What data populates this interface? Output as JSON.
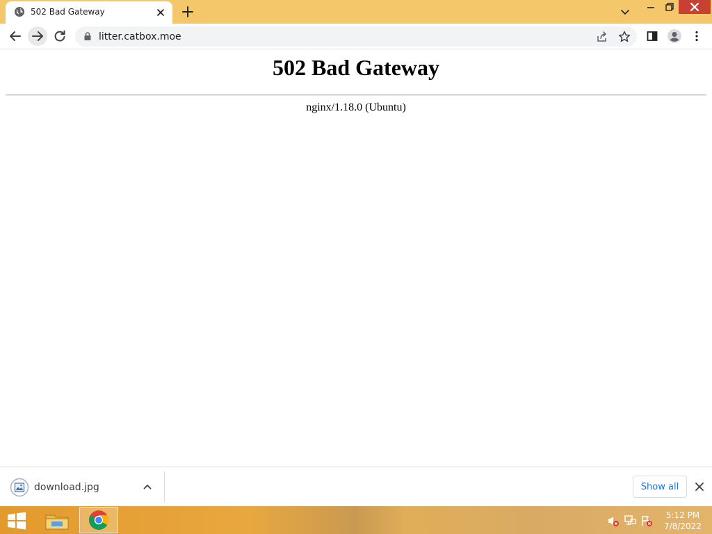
{
  "browser": {
    "tab": {
      "title": "502 Bad Gateway",
      "favicon": "globe-icon"
    },
    "address_bar": {
      "url": "litter.catbox.moe"
    }
  },
  "page": {
    "heading": "502 Bad Gateway",
    "server_info": "nginx/1.18.0 (Ubuntu)"
  },
  "download_shelf": {
    "item": {
      "filename": "download.jpg"
    },
    "show_all_label": "Show all"
  },
  "taskbar": {
    "time": "5:12 PM",
    "date": "7/8/2022"
  },
  "colors": {
    "tabstrip": "#f3c76a",
    "close_button": "#c84031",
    "show_all_text": "#1a73e8"
  }
}
